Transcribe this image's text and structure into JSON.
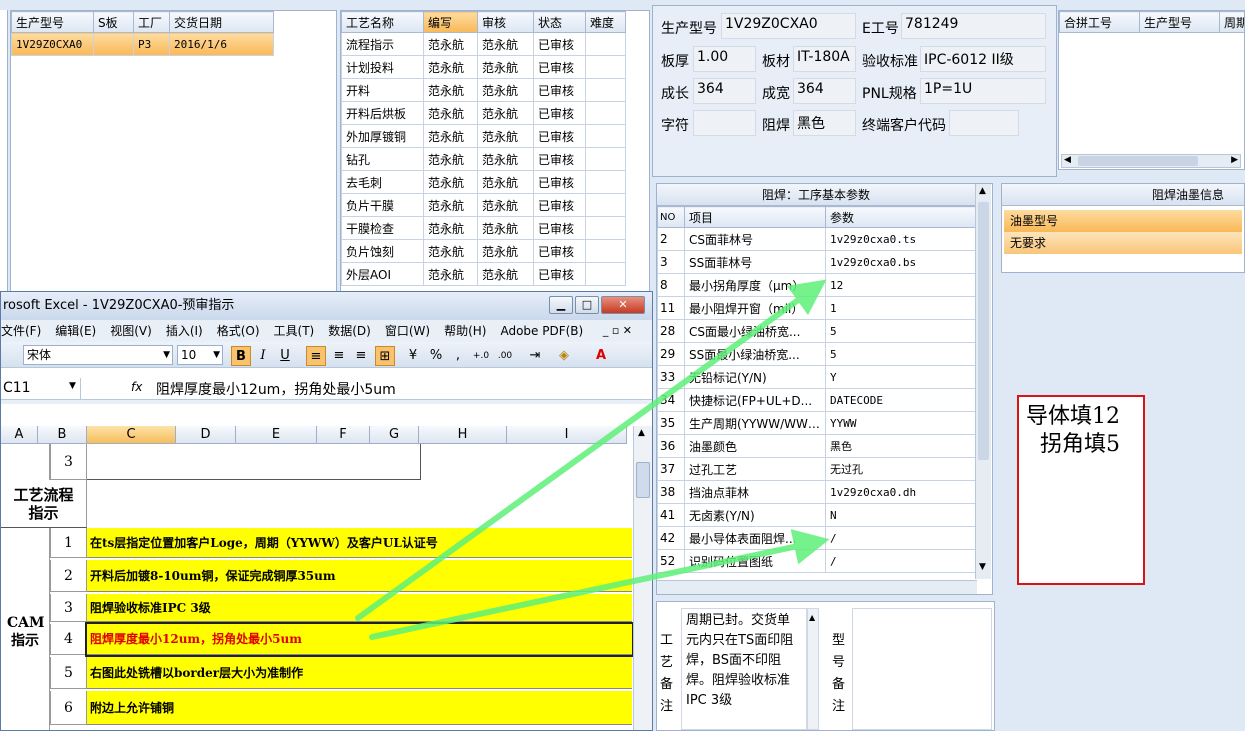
{
  "order_table": {
    "headers": [
      "生产型号",
      "S板",
      "工厂",
      "交货日期"
    ],
    "rows": [
      [
        "1V29Z0CXA0",
        "",
        "P3",
        "2016/1/6"
      ]
    ]
  },
  "process_table": {
    "headers": [
      "工艺名称",
      "编写",
      "审核",
      "状态",
      "难度"
    ],
    "rows": [
      [
        "流程指示",
        "范永航",
        "范永航",
        "已审核",
        ""
      ],
      [
        "计划投料",
        "范永航",
        "范永航",
        "已审核",
        ""
      ],
      [
        "开料",
        "范永航",
        "范永航",
        "已审核",
        ""
      ],
      [
        "开料后烘板",
        "范永航",
        "范永航",
        "已审核",
        ""
      ],
      [
        "外加厚镀铜",
        "范永航",
        "范永航",
        "已审核",
        ""
      ],
      [
        "钻孔",
        "范永航",
        "范永航",
        "已审核",
        ""
      ],
      [
        "去毛刺",
        "范永航",
        "范永航",
        "已审核",
        ""
      ],
      [
        "负片干膜",
        "范永航",
        "范永航",
        "已审核",
        ""
      ],
      [
        "干膜检查",
        "范永航",
        "范永航",
        "已审核",
        ""
      ],
      [
        "负片蚀刻",
        "范永航",
        "范永航",
        "已审核",
        ""
      ],
      [
        "外层AOI",
        "范永航",
        "范永航",
        "已审核",
        ""
      ]
    ]
  },
  "info": {
    "model_label": "生产型号",
    "model": "1V29Z0CXA0",
    "e_label": "E工号",
    "e_no": "781249",
    "thickness_label": "板厚",
    "thickness": "1.00",
    "material_label": "板材",
    "material": "IT-180A",
    "standard_label": "验收标准",
    "standard": "IPC-6012 II级",
    "length_label": "成长",
    "length": "364",
    "width_label": "成宽",
    "width": "364",
    "pnl_label": "PNL规格",
    "pnl": "1P=1U",
    "char_label": "字符",
    "char": "",
    "mask_label": "阻焊",
    "mask": "黑色",
    "customer_label": "终端客户代码",
    "customer": ""
  },
  "merge_table": {
    "headers": [
      "合拼工号",
      "生产型号",
      "周期"
    ]
  },
  "params": {
    "title": "阻焊：工序基本参数",
    "headers": [
      "NO",
      "项目",
      "参数"
    ],
    "rows": [
      [
        "2",
        "CS面菲林号",
        "1v29z0cxa0.ts"
      ],
      [
        "3",
        "SS面菲林号",
        "1v29z0cxa0.bs"
      ],
      [
        "8",
        "最小拐角厚度（μm）",
        "12"
      ],
      [
        "11",
        "最小阻焊开窗（mil）",
        "1"
      ],
      [
        "28",
        "CS面最小绿油桥宽...",
        "5"
      ],
      [
        "29",
        "SS面最小绿油桥宽...",
        "5"
      ],
      [
        "33",
        "无铅标记(Y/N)",
        "Y"
      ],
      [
        "34",
        "快捷标记(FP+UL+D...",
        "DATECODE"
      ],
      [
        "35",
        "生产周期(YYWW/WWYY)",
        "YYWW"
      ],
      [
        "36",
        "油墨颜色",
        "黑色"
      ],
      [
        "37",
        "过孔工艺",
        "无过孔"
      ],
      [
        "38",
        "挡油点菲林",
        "1v29z0cxa0.dh"
      ],
      [
        "41",
        "无卤素(Y/N)",
        "N"
      ],
      [
        "42",
        "最小导体表面阻焊...",
        "/"
      ],
      [
        "52",
        "识别码位置图纸",
        "/"
      ]
    ]
  },
  "ink": {
    "title": "阻焊油墨信息",
    "header": "油墨型号",
    "value": "无要求"
  },
  "notes": {
    "process_label": "工艺备注",
    "process_text": "周期已封。交货单元内只在TS面印阻焊，BS面不印阻焊。阻焊验收标准IPC 3级",
    "model_label": "型号备注"
  },
  "annotation": {
    "line1": "导体填12",
    "line2": "拐角填5"
  },
  "excel": {
    "title": "rosoft Excel - 1V29Z0CXA0-预审指示",
    "menu": [
      "文件(F)",
      "编辑(E)",
      "视图(V)",
      "插入(I)",
      "格式(O)",
      "工具(T)",
      "数据(D)",
      "窗口(W)",
      "帮助(H)",
      "Adobe PDF(B)"
    ],
    "font": "宋体",
    "size": "10",
    "name_box": "C11",
    "formula": "阻焊厚度最小12um，拐角处最小5um",
    "cols": [
      "A",
      "B",
      "C",
      "D",
      "E",
      "F",
      "G",
      "H",
      "I"
    ],
    "row3": "3",
    "section1": "工艺流程指示",
    "section2": "CAM指示",
    "items": [
      {
        "n": "1",
        "text": "在ts层指定位置加客户Loge，周期（YYWW）及客户UL认证号"
      },
      {
        "n": "2",
        "text": "开料后加镀8-10um铜，保证完成铜厚35um"
      },
      {
        "n": "3",
        "text": "阻焊验收标准IPC 3级"
      },
      {
        "n": "4",
        "text": "阻焊厚度最小12um，拐角处最小5um"
      },
      {
        "n": "5",
        "text": "右图此处铣槽以border层大小为准制作"
      },
      {
        "n": "6",
        "text": "附边上允许铺铜"
      }
    ]
  },
  "colors": {
    "highlight": "#ffff00",
    "arrow": "#5ff07a",
    "accent": "#f9b857"
  }
}
